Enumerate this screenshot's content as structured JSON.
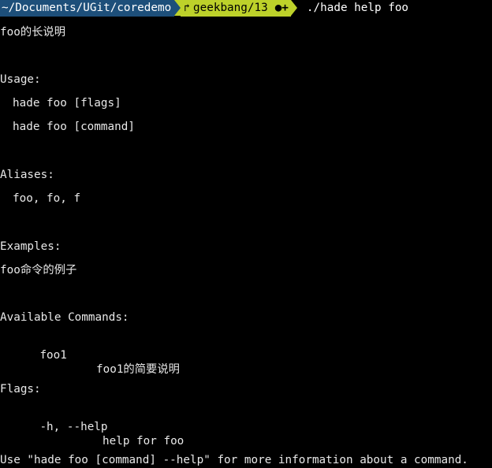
{
  "prompt": {
    "directory": "~/Documents/UGit/coredemo",
    "branch_icon": "branch-icon",
    "branch": "geekbang/13",
    "dirty_marker": "●+",
    "command": "./hade help foo"
  },
  "output": {
    "long_description": "foo的长说明",
    "usage_heading": "Usage:",
    "usage_lines": [
      "hade foo [flags]",
      "hade foo [command]"
    ],
    "aliases_heading": "Aliases:",
    "aliases": "foo, fo, f",
    "examples_heading": "Examples:",
    "example_text": "foo命令的例子",
    "commands_heading": "Available Commands:",
    "commands": [
      {
        "name": "foo1",
        "description": "foo1的简要说明"
      }
    ],
    "flags_heading": "Flags:",
    "flags": [
      {
        "flag": "-h, --help",
        "description": "help for foo"
      }
    ],
    "footer": "Use \"hade foo [command] --help\" for more information about a command."
  },
  "colors": {
    "background": "#000000",
    "text": "#e8e8e8",
    "dir_segment": "#1d4f7a",
    "git_segment": "#bdd12a"
  }
}
